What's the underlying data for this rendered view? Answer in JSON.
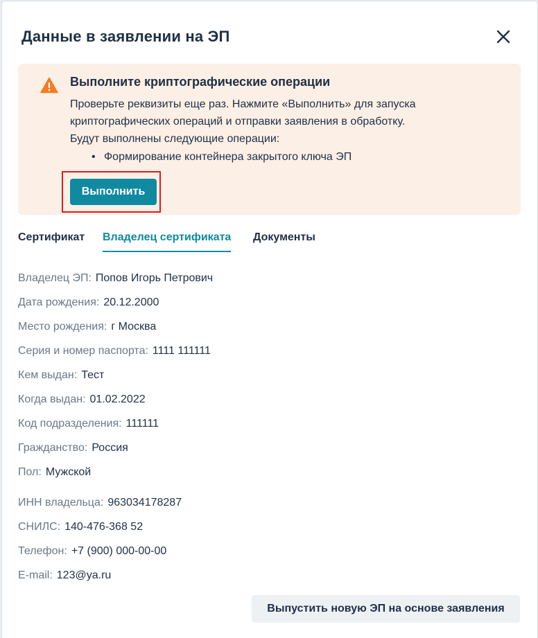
{
  "modal": {
    "title": "Данные в заявлении на ЭП"
  },
  "alert": {
    "icon": "warning-icon",
    "accent_color": "#f47b20",
    "title": "Выполните криптографические операции",
    "line1": "Проверьте реквизиты еще раз. Нажмите «Выполнить» для запуска",
    "line2": "криптографических операций и отправки заявления в обработку.",
    "line3": "Будут выполнены следующие операции:",
    "operations": [
      "Формирование контейнера закрытого ключа ЭП"
    ],
    "run_label": "Выполнить"
  },
  "tabs": [
    {
      "label": "Сертификат"
    },
    {
      "label": "Владелец сертификата"
    },
    {
      "label": "Документы"
    }
  ],
  "active_tab": "Владелец сертификата",
  "fields": [
    {
      "label": "Владелец ЭП:",
      "value": "Попов Игорь Петрович"
    },
    {
      "label": "Дата рождения:",
      "value": "20.12.2000"
    },
    {
      "label": "Место рождения:",
      "value": "г Москва"
    },
    {
      "label": "Серия и номер паспорта:",
      "value": "1111 111111"
    },
    {
      "label": "Кем выдан:",
      "value": "Тест"
    },
    {
      "label": "Когда выдан:",
      "value": "01.02.2022"
    },
    {
      "label": "Код подразделения:",
      "value": "111111"
    },
    {
      "label": "Гражданство:",
      "value": "Россия"
    },
    {
      "label": "Пол:",
      "value": "Мужской"
    },
    {
      "label": "ИНН владельца:",
      "value": "963034178287"
    },
    {
      "label": "СНИЛС:",
      "value": "140-476-368 52"
    },
    {
      "label": "Телефон:",
      "value": "+7 (900) 000-00-00"
    },
    {
      "label": "E-mail:",
      "value": "123@ya.ru"
    }
  ],
  "footer": {
    "issue_label": "Выпустить новую ЭП на основе заявления"
  },
  "colors": {
    "accent": "#0f8aa0",
    "alert_bg": "#fcefe6",
    "highlight": "#e01b1b"
  }
}
